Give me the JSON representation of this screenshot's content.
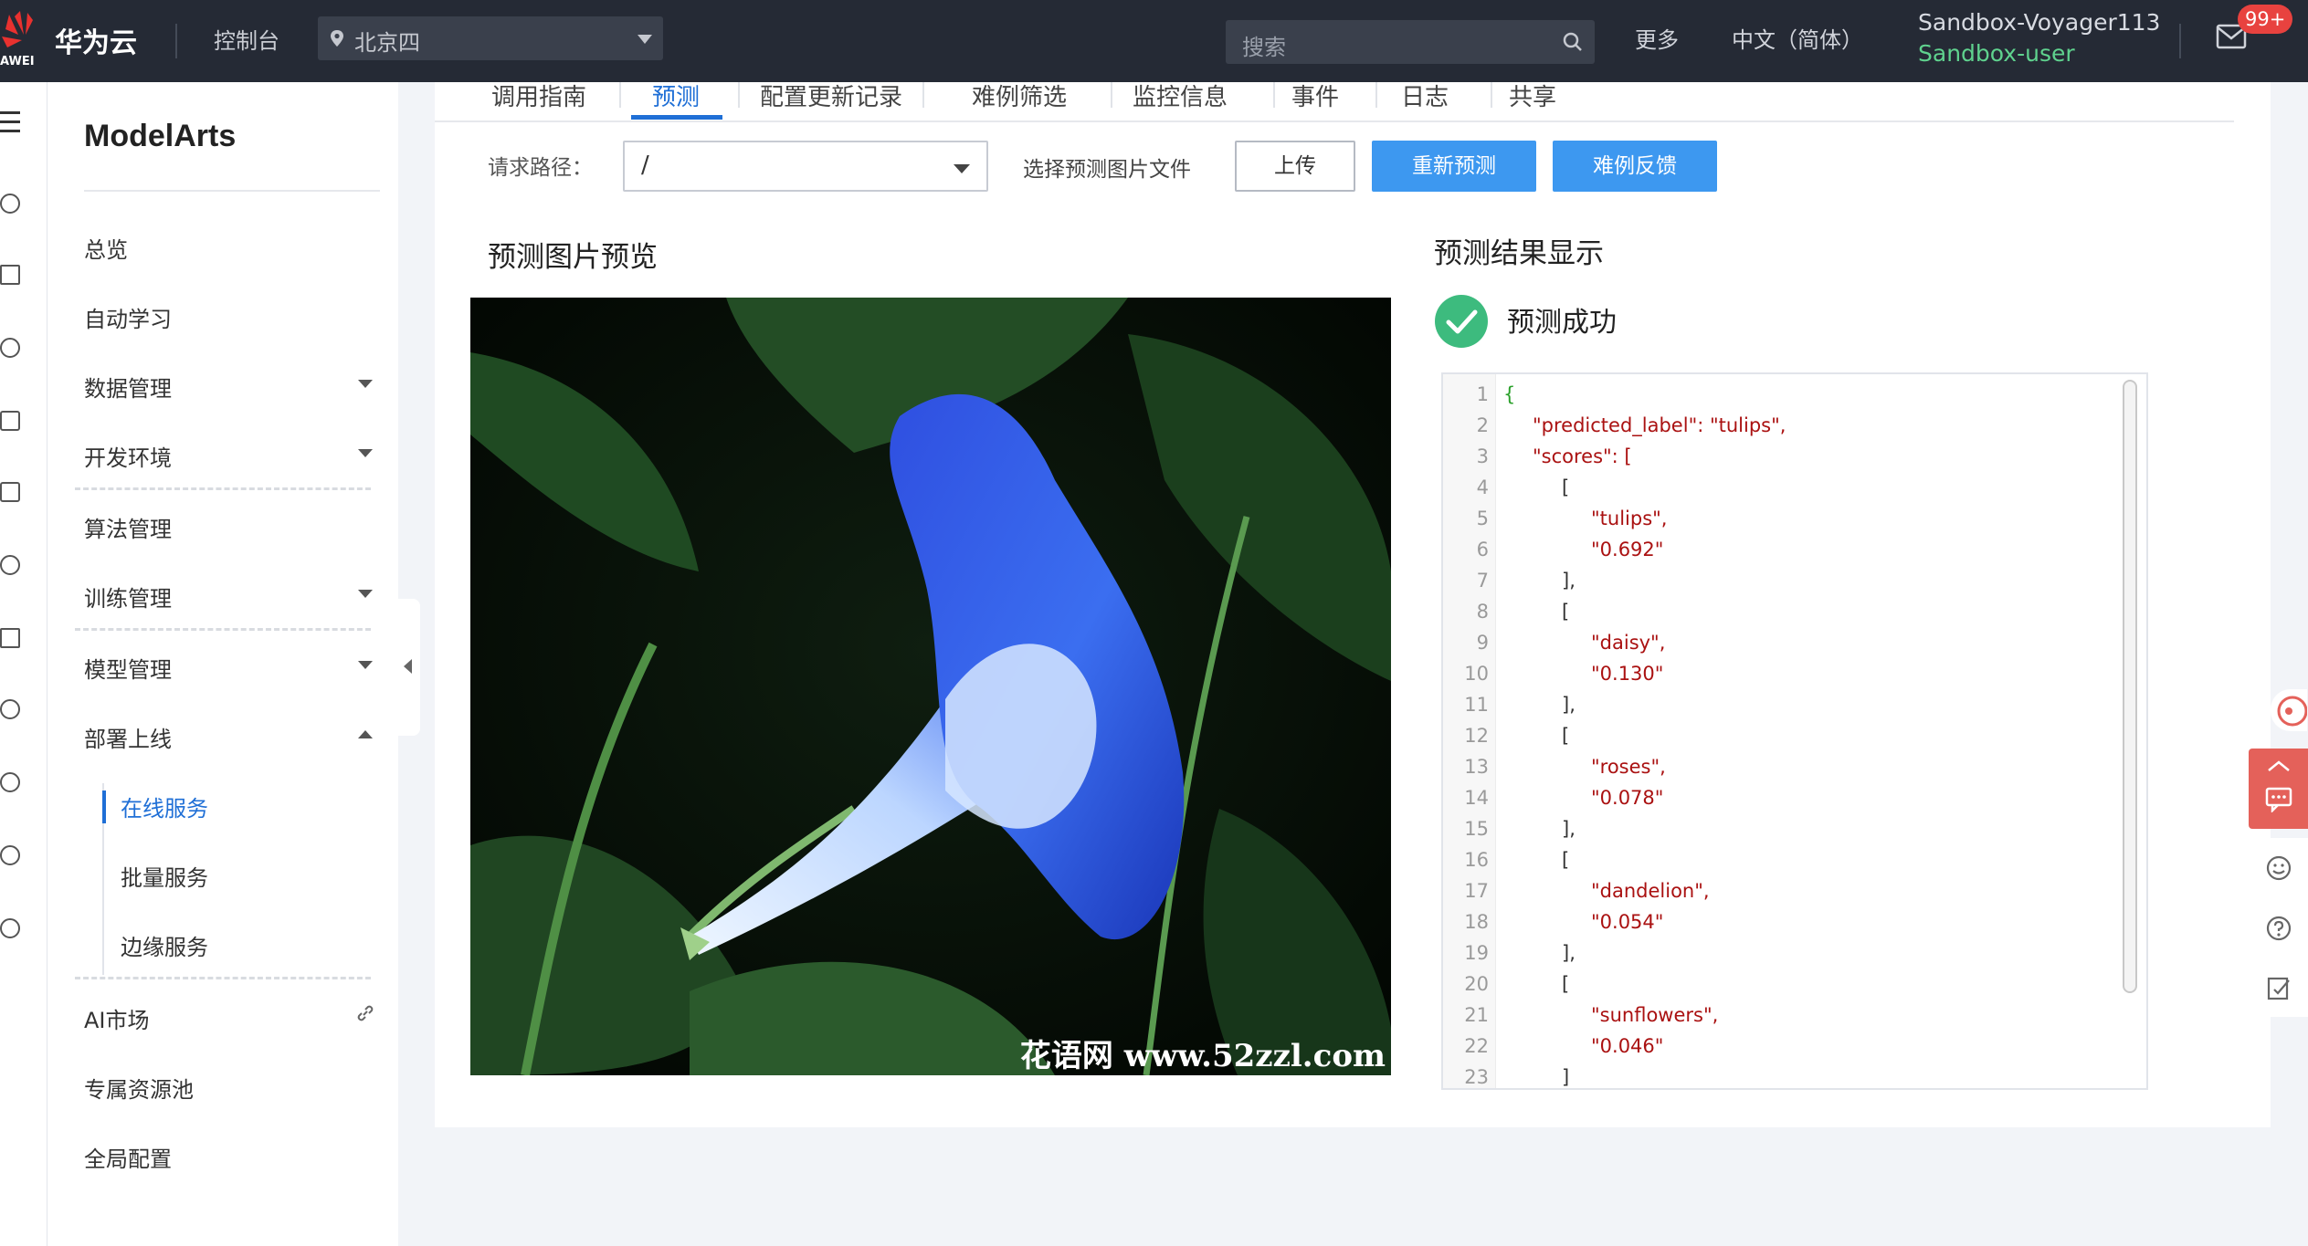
{
  "topbar": {
    "logo_text": "AWEI",
    "brand": "华为云",
    "console": "控制台",
    "region": "北京四",
    "search_placeholder": "搜索",
    "more": "更多",
    "language": "中文（简体）",
    "user_name": "Sandbox-Voyager113",
    "user_role": "Sandbox-user",
    "notification_count": "99+"
  },
  "sidebar": {
    "title": "ModelArts",
    "items": {
      "overview": "总览",
      "auto_learning": "自动学习",
      "data_management": "数据管理",
      "dev_env": "开发环境",
      "algorithm": "算法管理",
      "training": "训练管理",
      "model": "模型管理",
      "deploy": "部署上线",
      "online_service": "在线服务",
      "batch_service": "批量服务",
      "edge_service": "边缘服务",
      "ai_market": "AI市场",
      "dedicated_pool": "专属资源池",
      "global_config": "全局配置"
    }
  },
  "tabs": [
    "调用指南",
    "预测",
    "配置更新记录",
    "难例筛选",
    "监控信息",
    "事件",
    "日志",
    "共享"
  ],
  "toolbar": {
    "path_label": "请求路径：",
    "path_value": "/",
    "file_label": "选择预测图片文件",
    "upload": "上传",
    "repredict": "重新预测",
    "hard_example": "难例反馈"
  },
  "preview": {
    "title": "预测图片预览",
    "watermark": "花语网 www.52zzl.com"
  },
  "result": {
    "title": "预测结果显示",
    "status": "预测成功",
    "lines": [
      "{",
      "\"predicted_label\": \"tulips\",",
      "\"scores\": [",
      "[",
      "\"tulips\",",
      "\"0.692\"",
      "],",
      "[",
      "\"daisy\",",
      "\"0.130\"",
      "],",
      "[",
      "\"roses\",",
      "\"0.078\"",
      "],",
      "[",
      "\"dandelion\",",
      "\"0.054\"",
      "],",
      "[",
      "\"sunflowers\",",
      "\"0.046\"",
      "]"
    ]
  },
  "colors": {
    "accent": "#1f6fd6",
    "button_blue": "#3d98f0",
    "success": "#3dbb7e",
    "topbar": "#252a35"
  },
  "icons": {
    "region": "location-pin-icon",
    "search": "search-icon",
    "mail": "mail-icon",
    "success": "check-circle-icon"
  }
}
